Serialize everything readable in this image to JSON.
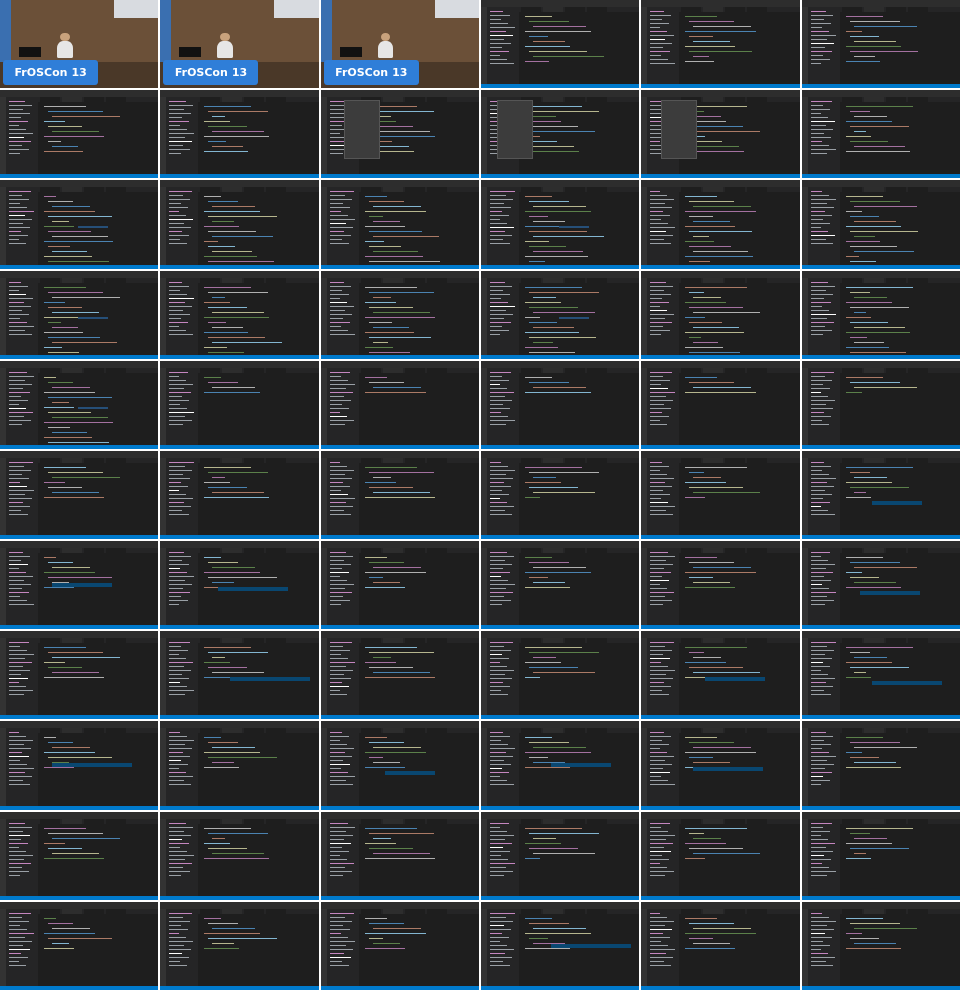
{
  "sheet": {
    "columns": 6,
    "rows": 11,
    "background": "#ffffff",
    "colors": {
      "editor_bg": "#1e1e1e",
      "sidebar_bg": "#252526",
      "activity_bar": "#333333",
      "titlebar": "#2d2d2d",
      "status_bar": "#007acc",
      "selection": "#264f78",
      "suggest": "#094771",
      "banner_blue": "#2f7ed8"
    }
  },
  "conference_banner": {
    "name": "FrOSCon",
    "number": "13"
  },
  "frames": [
    {
      "kind": "photo"
    },
    {
      "kind": "photo"
    },
    {
      "kind": "photo"
    },
    {
      "kind": "editor",
      "variant": "plain"
    },
    {
      "kind": "editor",
      "variant": "plain"
    },
    {
      "kind": "editor",
      "variant": "plain"
    },
    {
      "kind": "editor",
      "variant": "plain"
    },
    {
      "kind": "editor",
      "variant": "plain"
    },
    {
      "kind": "editor",
      "variant": "menu"
    },
    {
      "kind": "editor",
      "variant": "menu"
    },
    {
      "kind": "editor",
      "variant": "menu"
    },
    {
      "kind": "editor",
      "variant": "plain"
    },
    {
      "kind": "editor",
      "variant": "code"
    },
    {
      "kind": "editor",
      "variant": "code"
    },
    {
      "kind": "editor",
      "variant": "code"
    },
    {
      "kind": "editor",
      "variant": "code"
    },
    {
      "kind": "editor",
      "variant": "code"
    },
    {
      "kind": "editor",
      "variant": "code"
    },
    {
      "kind": "editor",
      "variant": "code"
    },
    {
      "kind": "editor",
      "variant": "code"
    },
    {
      "kind": "editor",
      "variant": "code"
    },
    {
      "kind": "editor",
      "variant": "code"
    },
    {
      "kind": "editor",
      "variant": "code"
    },
    {
      "kind": "editor",
      "variant": "code"
    },
    {
      "kind": "editor",
      "variant": "code"
    },
    {
      "kind": "editor",
      "variant": "dense"
    },
    {
      "kind": "editor",
      "variant": "dense"
    },
    {
      "kind": "editor",
      "variant": "dense"
    },
    {
      "kind": "editor",
      "variant": "dense"
    },
    {
      "kind": "editor",
      "variant": "dense"
    },
    {
      "kind": "editor",
      "variant": "sparse"
    },
    {
      "kind": "editor",
      "variant": "sparse"
    },
    {
      "kind": "editor",
      "variant": "sparse"
    },
    {
      "kind": "editor",
      "variant": "sparse"
    },
    {
      "kind": "editor",
      "variant": "sparse"
    },
    {
      "kind": "editor",
      "variant": "suggest"
    },
    {
      "kind": "editor",
      "variant": "suggest"
    },
    {
      "kind": "editor",
      "variant": "suggest"
    },
    {
      "kind": "editor",
      "variant": "sparse"
    },
    {
      "kind": "editor",
      "variant": "sparse"
    },
    {
      "kind": "editor",
      "variant": "sparse"
    },
    {
      "kind": "editor",
      "variant": "suggest"
    },
    {
      "kind": "editor",
      "variant": "sparse"
    },
    {
      "kind": "editor",
      "variant": "suggest"
    },
    {
      "kind": "editor",
      "variant": "sparse"
    },
    {
      "kind": "editor",
      "variant": "sparse"
    },
    {
      "kind": "editor",
      "variant": "suggest"
    },
    {
      "kind": "editor",
      "variant": "suggest"
    },
    {
      "kind": "editor",
      "variant": "suggest"
    },
    {
      "kind": "editor",
      "variant": "sparse"
    },
    {
      "kind": "editor",
      "variant": "suggest"
    },
    {
      "kind": "editor",
      "variant": "suggest"
    },
    {
      "kind": "editor",
      "variant": "suggest"
    },
    {
      "kind": "editor",
      "variant": "sparse"
    },
    {
      "kind": "editor",
      "variant": "sparse"
    },
    {
      "kind": "editor",
      "variant": "sparse"
    },
    {
      "kind": "editor",
      "variant": "sparse"
    },
    {
      "kind": "editor",
      "variant": "sparse"
    },
    {
      "kind": "editor",
      "variant": "sparse"
    },
    {
      "kind": "editor",
      "variant": "sparse"
    },
    {
      "kind": "editor",
      "variant": "sparse"
    },
    {
      "kind": "editor",
      "variant": "sparse"
    },
    {
      "kind": "editor",
      "variant": "sparse"
    },
    {
      "kind": "editor",
      "variant": "suggest"
    },
    {
      "kind": "editor",
      "variant": "sparse"
    },
    {
      "kind": "editor",
      "variant": "sparse"
    }
  ]
}
